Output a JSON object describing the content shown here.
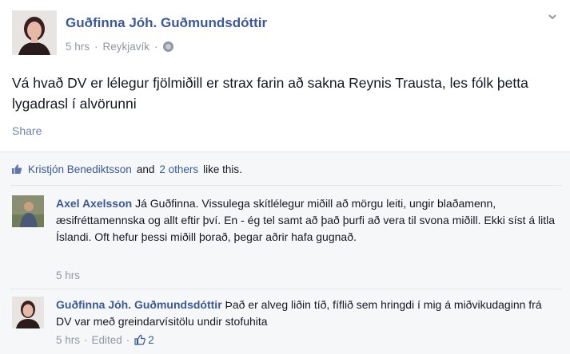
{
  "post": {
    "author": "Guðfinna Jóh. Guðmundsdóttir",
    "time": "5 hrs",
    "location": "Reykjavík",
    "text": "Vá hvað DV er lélegur fjölmiðill er strax farin að sakna Reynis Trausta, les fólk þetta lygadrasl í alvörunni",
    "share_label": "Share"
  },
  "likes": {
    "first_name": "Kristjón Benediktsson",
    "and": "and",
    "others": "2 others",
    "suffix": "like this."
  },
  "comments": [
    {
      "author": "Axel Axelsson",
      "text": "Já Guðfinna. Vissulega skítlélegur miðill að mörgu leiti, ungir blaðamenn, æsifréttamennska og allt eftir því. En - ég tel samt að það þurfi að vera til svona miðill. Ekki síst á litla Íslandi. Oft hefur þessi miðill þorað, þegar aðrir hafa gugnað.",
      "time": "5 hrs"
    },
    {
      "author": "Guðfinna Jóh. Guðmundsdóttir",
      "text": "Það er alveg liðin tíð, fíflið sem hringdi í mig á miðvikudaginn frá DV var með greindarvísitölu undir stofuhita",
      "time": "5 hrs",
      "dot": "·",
      "edited": "Edited",
      "like_count": "2"
    }
  ],
  "meta_dot": "·",
  "colors": {
    "link": "#3b5998",
    "muted": "#9197a3",
    "feedback_bg": "#f6f7f8"
  },
  "icons": [
    "globe-icon",
    "chevron-down-icon",
    "like-thumb-icon"
  ]
}
